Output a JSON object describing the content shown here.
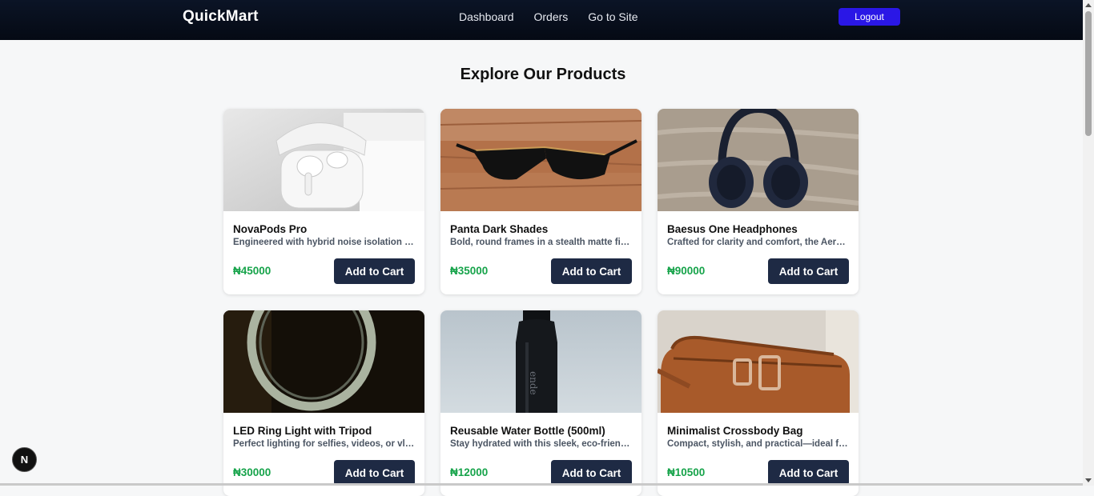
{
  "nav": {
    "brand": "QuickMart",
    "links": [
      "Dashboard",
      "Orders",
      "Go to Site"
    ],
    "logout_label": "Logout"
  },
  "main": {
    "title": "Explore Our Products",
    "add_label": "Add to Cart",
    "products": [
      {
        "name": "NovaPods Pro",
        "desc": "Engineered with hybrid noise isolation technology",
        "price": "₦45000",
        "image": "earbuds-image"
      },
      {
        "name": "Panta Dark Shades",
        "desc": "Bold, round frames in a stealth matte finish",
        "price": "₦35000",
        "image": "sunglasses-image"
      },
      {
        "name": "Baesus One Headphones",
        "desc": "Crafted for clarity and comfort, the Aero series",
        "price": "₦90000",
        "image": "headphones-image"
      },
      {
        "name": "LED Ring Light with Tripod",
        "desc": "Perfect lighting for selfies, videos, or vlogs",
        "price": "₦30000",
        "image": "ring-light-image"
      },
      {
        "name": "Reusable Water Bottle (500ml)",
        "desc": "Stay hydrated with this sleek, eco-friendly bottle",
        "price": "₦12000",
        "image": "water-bottle-image"
      },
      {
        "name": "Minimalist Crossbody Bag",
        "desc": "Compact, stylish, and practical—ideal for daily use",
        "price": "₦10500",
        "image": "crossbody-bag-image"
      }
    ]
  },
  "fab_label": "N",
  "colors": {
    "accent": "#2a17e6",
    "price": "#16a34a",
    "button": "#1e2a44",
    "nav_bg": "#050a14"
  }
}
